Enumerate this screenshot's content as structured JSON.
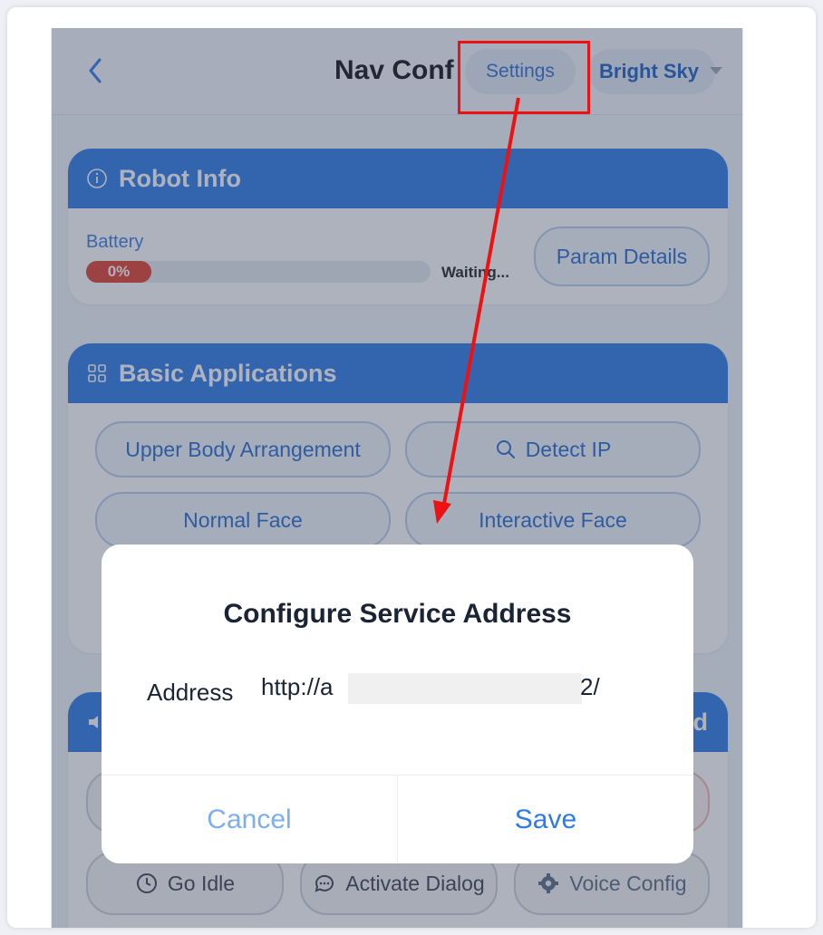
{
  "header": {
    "title": "Nav Conf",
    "settings_label": "Settings",
    "theme_label": "Bright Sky"
  },
  "robot_info": {
    "title": "Robot Info",
    "battery_label": "Battery",
    "battery_percent_text": "0%",
    "battery_level": 0,
    "status_text": "Waiting...",
    "param_details_label": "Param Details"
  },
  "basic_apps": {
    "title": "Basic Applications",
    "buttons": [
      "Upper Body Arrangement",
      "Detect IP",
      "Normal Face",
      "Interactive Face"
    ]
  },
  "voice_section": {
    "title_fragment": "ed",
    "buttons": [
      "Go Idle",
      "Activate Dialog",
      "Voice Config"
    ]
  },
  "dialog": {
    "title": "Configure Service Address",
    "field_label": "Address",
    "field_value_prefix": "http://a",
    "field_value_suffix": "2/",
    "cancel_label": "Cancel",
    "save_label": "Save"
  },
  "colors": {
    "primary": "#2e7be8",
    "battery_red": "#e43e30",
    "annotation_red": "#ee1111"
  },
  "icons": [
    "chevron-left-icon",
    "info-icon",
    "grid-icon",
    "search-icon",
    "speaker-icon",
    "clock-icon",
    "chat-icon",
    "gear-icon"
  ]
}
